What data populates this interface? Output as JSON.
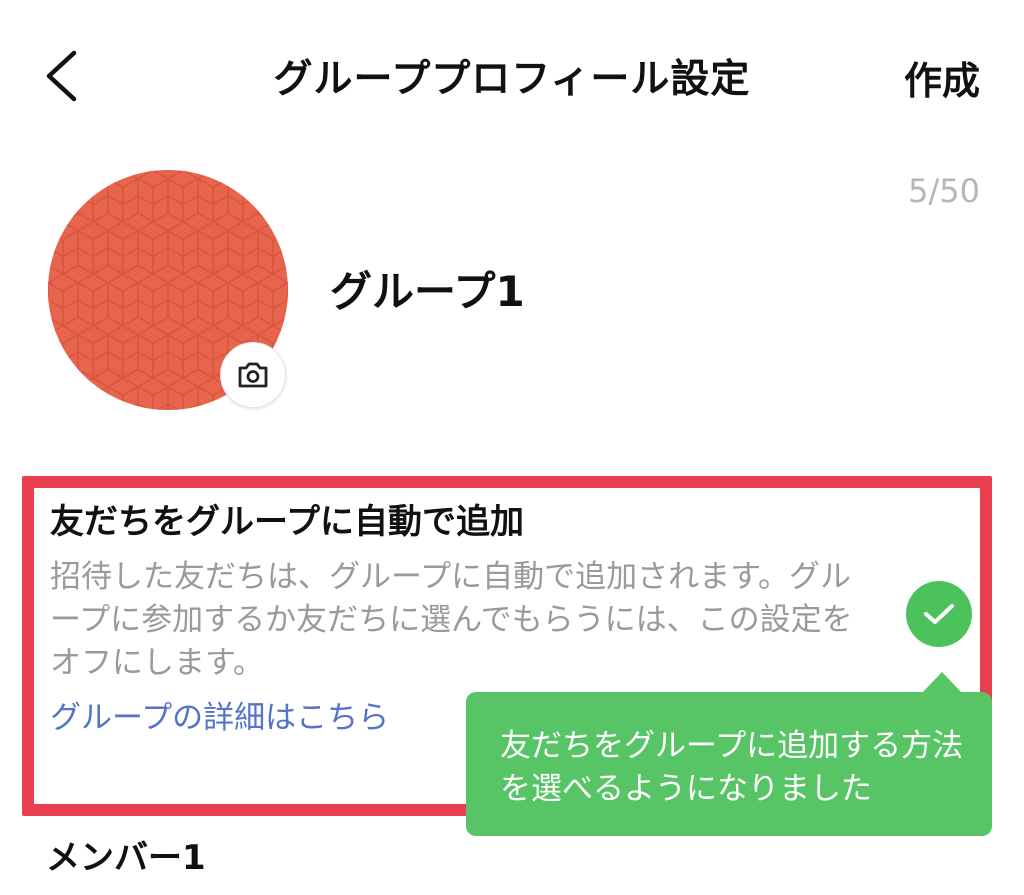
{
  "header": {
    "back_icon": "chevron-left-icon",
    "title": "グループプロフィール設定",
    "create_label": "作成"
  },
  "profile": {
    "name_counter": "5/50",
    "group_name": "グループ1",
    "avatar_color": "#e8654d",
    "camera_icon": "camera-icon"
  },
  "auto_add_setting": {
    "title": "友だちをグループに自動で追加",
    "description": "招待した友だちは、グループに自動で追加されます。グループに参加するか友だちに選んでもらうには、この設定をオフにします。",
    "link": "グループの詳細はこちら",
    "enabled": true,
    "check_icon": "check-icon",
    "toggle_color": "#4cc25c"
  },
  "tooltip": {
    "text": "友だちをグループに追加する方法を選べるようになりました",
    "color": "#57c465"
  },
  "highlight_color": "#e8404e",
  "members": {
    "label": "メンバー1"
  }
}
